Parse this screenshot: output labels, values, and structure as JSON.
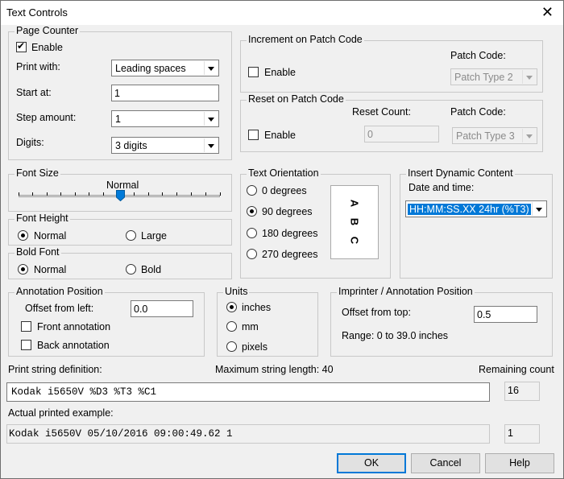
{
  "window": {
    "title": "Text Controls",
    "close_glyph": "✕"
  },
  "page_counter": {
    "legend": "Page Counter",
    "enable_label": "Enable",
    "enable_checked": true,
    "print_with_label": "Print with:",
    "print_with_value": "Leading spaces",
    "start_at_label": "Start at:",
    "start_at_value": "1",
    "step_label": "Step amount:",
    "step_value": "1",
    "digits_label": "Digits:",
    "digits_value": "3 digits"
  },
  "increment": {
    "legend": "Increment on Patch Code",
    "enable_label": "Enable",
    "patch_code_label": "Patch Code:",
    "patch_code_value": "Patch Type 2"
  },
  "reset": {
    "legend": "Reset on Patch Code",
    "enable_label": "Enable",
    "reset_count_label": "Reset Count:",
    "reset_count_value": "0",
    "patch_code_label": "Patch Code:",
    "patch_code_value": "Patch Type 3"
  },
  "font_size": {
    "legend": "Font Size",
    "value_label": "Normal"
  },
  "font_height": {
    "legend": "Font Height",
    "normal": "Normal",
    "large": "Large",
    "selected": "Normal"
  },
  "bold_font": {
    "legend": "Bold Font",
    "normal": "Normal",
    "bold": "Bold",
    "selected": "Normal"
  },
  "orientation": {
    "legend": "Text Orientation",
    "options": [
      "0 degrees",
      "90 degrees",
      "180 degrees",
      "270 degrees"
    ],
    "selected": "90 degrees",
    "preview": [
      "A",
      "B",
      "C"
    ]
  },
  "dynamic": {
    "legend": "Insert Dynamic Content",
    "date_label": "Date and time:",
    "date_value": "HH:MM:SS.XX 24hr (%T3)"
  },
  "annotation": {
    "legend": "Annotation Position",
    "offset_label": "Offset from left:",
    "offset_value": "0.0",
    "front_label": "Front annotation",
    "back_label": "Back annotation"
  },
  "units": {
    "legend": "Units",
    "inches": "inches",
    "mm": "mm",
    "pixels": "pixels",
    "selected": "inches"
  },
  "imprinter": {
    "legend": "Imprinter / Annotation Position",
    "offset_label": "Offset from top:",
    "offset_value": "0.5",
    "range": "Range: 0 to 39.0 inches"
  },
  "print_string": {
    "label": "Print string definition:",
    "max_label": "Maximum string length: 40",
    "remaining_label": "Remaining count",
    "value": "Kodak i5650V %D3 %T3 %C1",
    "remaining_value": "16"
  },
  "example": {
    "label": "Actual printed example:",
    "value": "Kodak i5650V 05/10/2016 09:00:49.62   1",
    "count": "1"
  },
  "buttons": {
    "ok": "OK",
    "cancel": "Cancel",
    "help": "Help"
  }
}
